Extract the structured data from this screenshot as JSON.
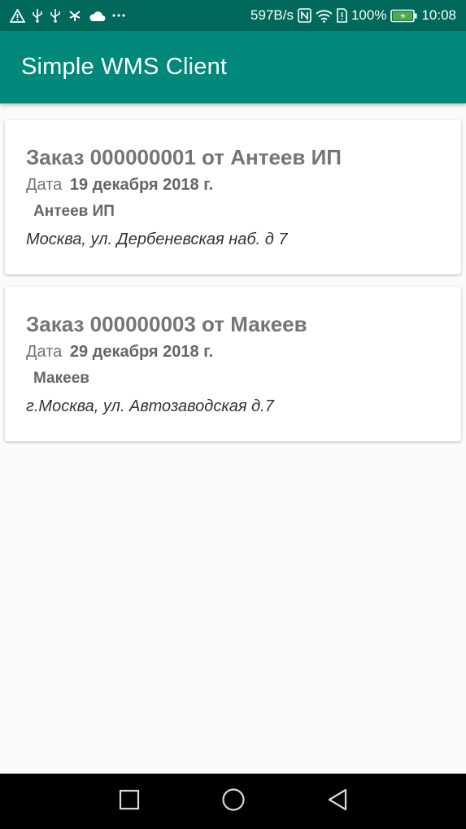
{
  "status_bar": {
    "icons_left": [
      "warning-icon",
      "usb-icon",
      "usb-icon",
      "app-icon",
      "cloud-icon",
      "more-icon"
    ],
    "speed": "597B/s",
    "battery": "100%",
    "time": "10:08",
    "colors": {
      "background": "#00695c",
      "battery_fill": "#4caf50"
    }
  },
  "app_bar": {
    "title": "Simple WMS Client",
    "color": "#00897b"
  },
  "orders": [
    {
      "title": "Заказ 000000001 от Антеев ИП",
      "date_label": "Дата",
      "date_value": "19 декабря 2018 г.",
      "customer": "Антеев ИП",
      "address": "Москва, ул. Дербеневская наб. д 7"
    },
    {
      "title": "Заказ 000000003 от Макеев",
      "date_label": "Дата",
      "date_value": "29 декабря 2018 г.",
      "customer": "Макеев",
      "address": "г.Москва, ул. Автозаводская д.7"
    }
  ],
  "nav_bar": {
    "buttons": [
      "recents-icon",
      "home-icon",
      "back-icon"
    ]
  }
}
